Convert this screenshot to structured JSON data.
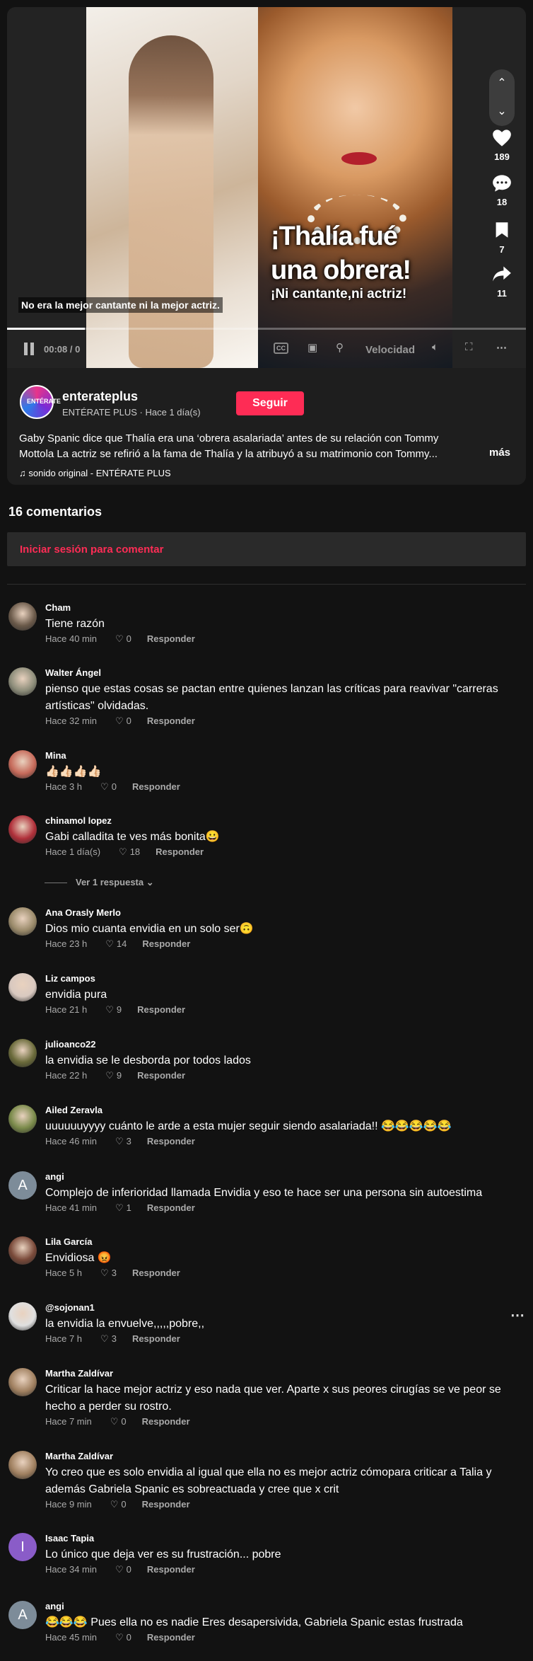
{
  "video": {
    "headline": "¡Thalía fué una obrera!",
    "subheadline": "¡Ni cantante,ni actriz!",
    "caption": "No era la mejor cantante ni la mejor actriz.",
    "progress": 0.15,
    "time": "00:08 / 0",
    "speed_label": "Velocidad",
    "scroll_up": "⌃",
    "scroll_down": "⌄",
    "likes": "189",
    "comments": "18",
    "saves": "7",
    "shares": "11",
    "icons": [
      "heart-icon",
      "comment-icon",
      "bookmark-icon",
      "share-icon",
      "pause-icon",
      "cc-icon",
      "pip-icon",
      "speed-icon",
      "volume-icon",
      "fullscreen-icon",
      "more-icon"
    ]
  },
  "author": {
    "avatar_text": "ENTÉRATE",
    "username": "enterateplus",
    "meta": "ENTÉRATE PLUS · Hace 1 día(s)",
    "follow_label": "Seguir",
    "description_line1": "Gaby Spanic dice que Thalía era una ‘obrera asalariada’ antes de su relación con Tommy",
    "description_line2": "Mottola La actriz se refirió a la fama de Thalía y la atribuyó a su matrimonio con Tommy...",
    "more_label": "más",
    "sound": "♫ sonido original - ENTÉRATE PLUS"
  },
  "comments_section": {
    "title": "16 comentarios",
    "login_prompt": "Iniciar sesión para comentar",
    "view_replies": "Ver 1 respuesta ⌄",
    "reply_label": "Responder",
    "more_options": "⋯"
  },
  "comments": [
    {
      "user": "Cham",
      "text": "Tiene razón",
      "date": "Hace 40 min",
      "likes": "0",
      "avatar_color": "#6b5a4a",
      "letter": ""
    },
    {
      "user": "Walter Ángel",
      "text": "pienso que estas cosas se pactan entre quienes lanzan las críticas para reavivar \"carreras artísticas\" olvidadas.",
      "date": "Hace 32 min",
      "likes": "0",
      "avatar_color": "#8d8d7a",
      "letter": ""
    },
    {
      "user": "Mina",
      "text": "👍🏻👍🏻👍🏻👍🏻",
      "date": "Hace 3 h",
      "likes": "0",
      "avatar_color": "#c66a5a",
      "letter": ""
    },
    {
      "user": "chinamol lopez",
      "text": "Gabi calladita te ves más bonita😀",
      "date": "Hace 1 día(s)",
      "likes": "18",
      "avatar_color": "#b0303a",
      "letter": ""
    },
    {
      "user": "Ana Orasly Merlo",
      "text": "Dios mio cuanta envidia en un solo ser🙃",
      "date": "Hace 23 h",
      "likes": "14",
      "avatar_color": "#9a8a6a",
      "letter": ""
    },
    {
      "user": "Liz campos",
      "text": "envidia pura",
      "date": "Hace 21 h",
      "likes": "9",
      "avatar_color": "#d9c9c0",
      "letter": ""
    },
    {
      "user": "julioanco22",
      "text": "la envidia se le desborda por todos lados",
      "date": "Hace 22 h",
      "likes": "9",
      "avatar_color": "#6a6a3a",
      "letter": ""
    },
    {
      "user": "Ailed Zeravla",
      "text": "uuuuuuyyyy cuánto le arde a esta mujer seguir siendo asalariada!! 😂😂😂😂😂",
      "date": "Hace 46 min",
      "likes": "3",
      "avatar_color": "#7a8a4a",
      "letter": ""
    },
    {
      "user": "angi",
      "text": "Complejo de inferioridad llamada Envidia y eso te hace ser una persona sin autoestima",
      "date": "Hace 41 min",
      "likes": "1",
      "avatar_color": "#7d8c99",
      "letter": "A"
    },
    {
      "user": "Lila García",
      "text": "Envidiosa 😡",
      "date": "Hace 5 h",
      "likes": "3",
      "avatar_color": "#7a4a3a",
      "letter": ""
    },
    {
      "user": "@sojonan1",
      "text": "la envidia la envuelve,,,,,pobre,,",
      "date": "Hace 7 h",
      "likes": "3",
      "avatar_color": "#e0e0e0",
      "letter": ""
    },
    {
      "user": "Martha Zaldívar",
      "text": "Criticar la hace mejor actriz y eso nada que ver. Aparte x sus peores cirugías se ve peor se hecho a perder su rostro.",
      "date": "Hace 7 min",
      "likes": "0",
      "avatar_color": "#a08060",
      "letter": ""
    },
    {
      "user": "Martha Zaldívar",
      "text": "Yo creo que es solo envidia al igual que ella no es mejor actriz cómopara criticar a Talia y además Gabriela Spanic es sobreactuada y cree que x crit",
      "date": "Hace 9 min",
      "likes": "0",
      "avatar_color": "#a08060",
      "letter": ""
    },
    {
      "user": "Isaac Tapia",
      "text": "Lo único que deja ver es su frustración... pobre",
      "date": "Hace 34 min",
      "likes": "0",
      "avatar_color": "#8a5cc8",
      "letter": "I"
    },
    {
      "user": "angi",
      "text": "😂😂😂 Pues ella no es nadie Eres desapersivida, Gabriela Spanic estas frustrada",
      "date": "Hace 45 min",
      "likes": "0",
      "avatar_color": "#7d8c99",
      "letter": "A"
    }
  ]
}
